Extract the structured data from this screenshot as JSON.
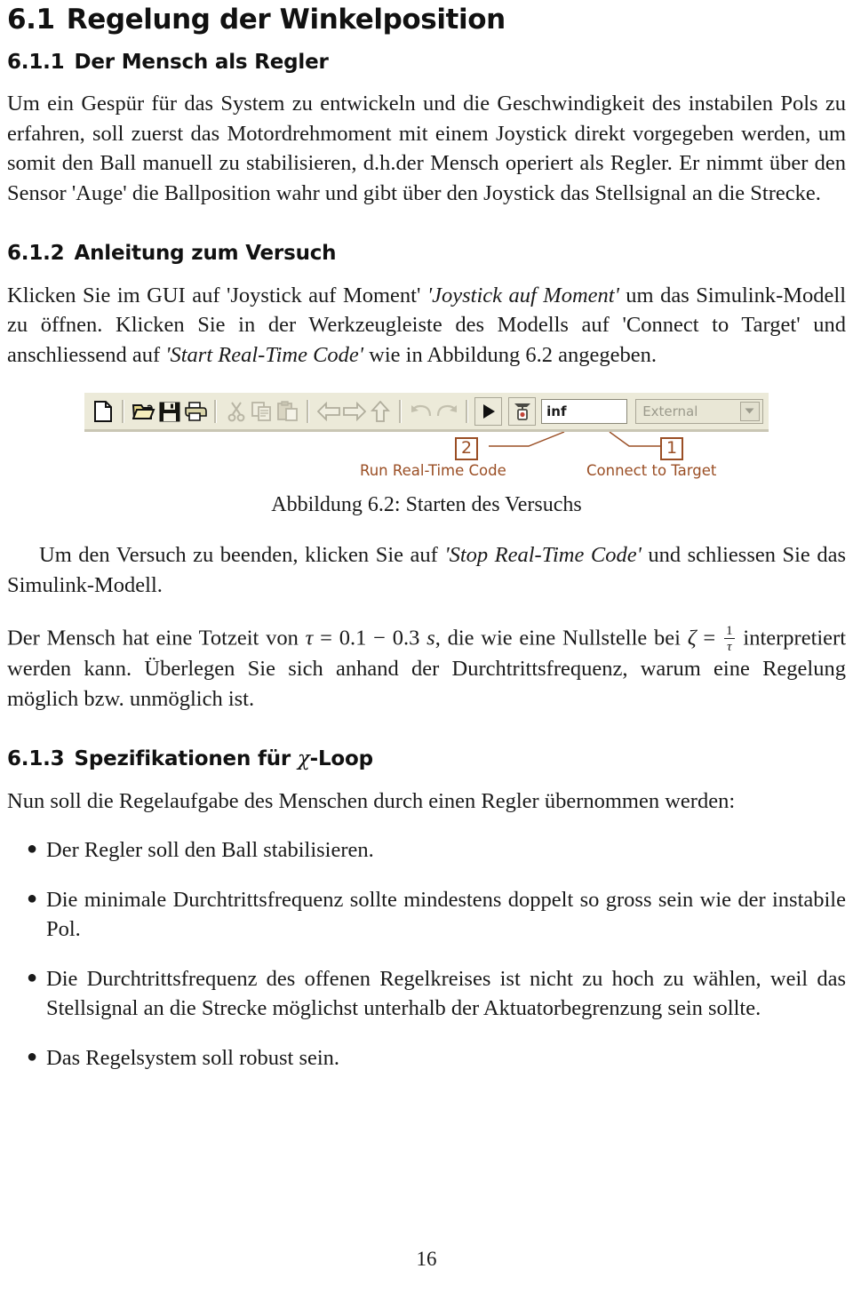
{
  "document": {
    "page_number": "16"
  },
  "section": {
    "number": "6.1",
    "title": "Regelung der Winkelposition"
  },
  "subsection_1": {
    "number": "6.1.1",
    "title": "Der Mensch als Regler",
    "paragraph": "Um ein Gespür für das System zu entwickeln und die Geschwindigkeit des instabilen Pols zu erfahren, soll zuerst das Motordrehmoment mit einem Joystick direkt vorgegeben werden, um somit den Ball manuell zu stabilisieren, d.h.der Mensch operiert als Regler. Er nimmt über den Sensor 'Auge' die Ballposition wahr und gibt über den Joystick das Stellsignal an die Strecke."
  },
  "subsection_2": {
    "number": "6.1.2",
    "title": "Anleitung zum Versuch",
    "paragraph_part1": "Klicken Sie im GUI auf 'Joystick auf Moment' ",
    "paragraph_italic1": "'Joystick auf Moment'",
    "paragraph_part2": " um das Simulink-Modell zu öffnen. Klicken Sie in der Werkzeugleiste des Modells auf 'Connect to Target' und anschliessend auf ",
    "paragraph_italic2": "'Start Real-Time Code'",
    "paragraph_part3": " wie in Abbildung 6.2 angegeben."
  },
  "figure": {
    "caption": "Abbildung 6.2: Starten des Versuchs",
    "toolbar": {
      "icons": [
        {
          "name": "new-file-icon",
          "glyph": "new"
        },
        {
          "name": "open-folder-icon",
          "glyph": "open"
        },
        {
          "name": "save-icon",
          "glyph": "save"
        },
        {
          "name": "print-icon",
          "glyph": "print"
        },
        {
          "name": "cut-icon",
          "glyph": "cut"
        },
        {
          "name": "copy-icon",
          "glyph": "copy"
        },
        {
          "name": "paste-icon",
          "glyph": "paste"
        },
        {
          "name": "back-arrow-icon",
          "glyph": "back"
        },
        {
          "name": "forward-arrow-icon",
          "glyph": "forward"
        },
        {
          "name": "up-arrow-icon",
          "glyph": "up"
        },
        {
          "name": "undo-icon",
          "glyph": "undo"
        },
        {
          "name": "redo-icon",
          "glyph": "redo"
        },
        {
          "name": "run-icon",
          "glyph": "play"
        },
        {
          "name": "connect-to-target-icon",
          "glyph": "target"
        }
      ],
      "stop_time_value": "inf",
      "simulation_mode_value": "External"
    },
    "callouts": [
      {
        "number": "2",
        "label": "Run Real-Time Code"
      },
      {
        "number": "1",
        "label": "Connect to Target"
      }
    ],
    "callout_color": "#9a4e24"
  },
  "after_figure": {
    "paragraph_part1": "Um den Versuch zu beenden, klicken Sie auf ",
    "paragraph_italic": "'Stop Real-Time Code'",
    "paragraph_part2": " und schliessen Sie das Simulink-Modell."
  },
  "deadtime_paragraph": {
    "part1": "Der Mensch hat eine Totzeit von ",
    "tau": "τ",
    "equals1": " = ",
    "range": "0.1 − 0.3",
    "unit": "s",
    "part2": ", die wie eine Nullstelle bei ",
    "zeta": "ζ",
    "equals2": " = ",
    "frac_numerator": "1",
    "frac_denominator": "τ",
    "part3": "interpretiert werden kann. Überlegen Sie sich anhand der Durchtrittsfrequenz, warum eine Regelung möglich bzw. unmöglich ist."
  },
  "subsection_3": {
    "number": "6.1.3",
    "title_part1": "Spezifikationen für ",
    "title_symbol": "χ",
    "title_part2": "-Loop",
    "intro": "Nun soll die Regelaufgabe des Menschen durch einen Regler übernommen werden:",
    "bullets": [
      "Der Regler soll den Ball stabilisieren.",
      "Die minimale Durchtrittsfrequenz sollte mindestens doppelt so gross sein wie der instabile Pol.",
      "Die Durchtrittsfrequenz des offenen Regelkreises ist nicht zu hoch zu wählen, weil das Stellsignal an die Strecke möglichst unterhalb der Aktuatorbegrenzung sein sollte.",
      "Das Regelsystem soll robust sein."
    ]
  }
}
